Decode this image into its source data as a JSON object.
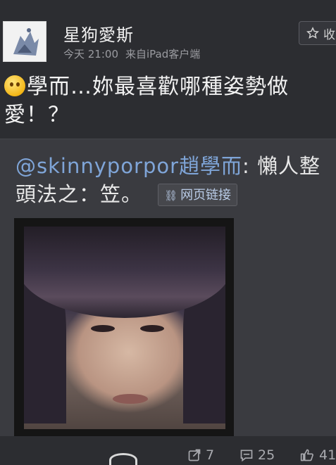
{
  "post": {
    "username": "星狗愛斯",
    "time": "今天 21:00",
    "source": "来自iPad客户端",
    "favorite_label": "收",
    "text": "學而…妳最喜歡哪種姿勢做愛！？"
  },
  "repost": {
    "mention": "@skinnyporpor趙學而",
    "text": ": 懶人整頭法之：笠。",
    "link_label": "网页链接"
  },
  "actions": {
    "repost_count": "7",
    "comment_count": "25",
    "like_count": "41"
  },
  "icons": {
    "emoji": "smile-emoji-icon",
    "favorite": "star-icon",
    "link": "link-chain-icon",
    "repost": "repost-icon",
    "comment": "comment-icon",
    "like": "thumbs-up-icon"
  }
}
